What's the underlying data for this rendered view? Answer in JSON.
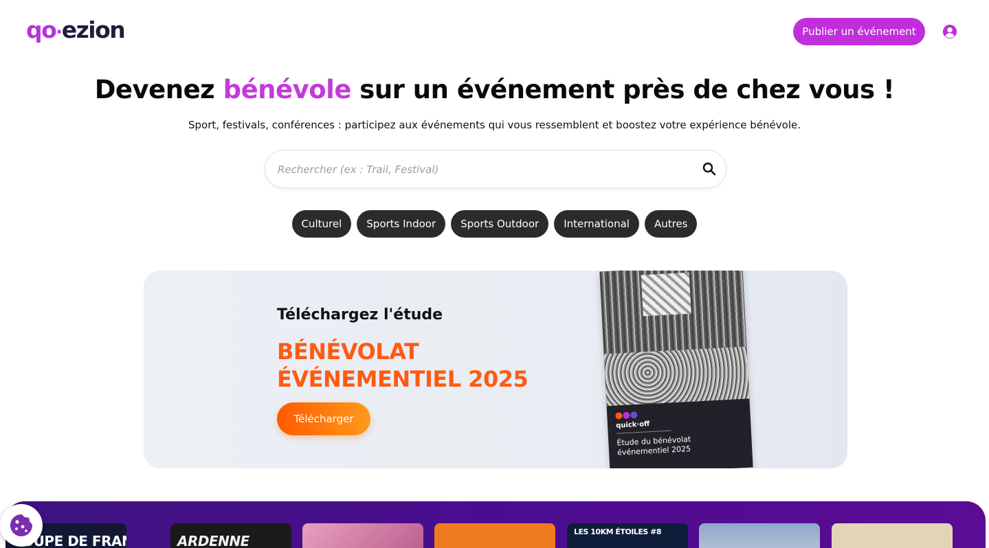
{
  "header": {
    "logo": {
      "part1": "qo",
      "separator": "·",
      "part2": "ezion"
    },
    "publish_label": "Publier un événement",
    "user_icon": "user-circle-icon"
  },
  "hero": {
    "title_before": "Devenez ",
    "title_accent": "bénévole",
    "title_after": " sur un événement près de chez vous !",
    "subtitle": "Sport, festivals, conférences : participez aux événements qui vous ressemblent et boostez votre expérience bénévole."
  },
  "search": {
    "placeholder": "Rechercher (ex : Trail, Festival)",
    "icon": "search-icon"
  },
  "categories": [
    {
      "label": "Culturel"
    },
    {
      "label": "Sports Indoor"
    },
    {
      "label": "Sports Outdoor"
    },
    {
      "label": "International"
    },
    {
      "label": "Autres"
    }
  ],
  "banner": {
    "kicker": "Téléchargez l'étude",
    "title_line1": "BÉNÉVOLAT",
    "title_line2": "ÉVÉNEMENTIEL 2025",
    "button_label": "Télécharger",
    "cover": {
      "brand": "quick·off",
      "title": "Étude du bénévolat événementiel 2025"
    }
  },
  "events_carousel": [
    {
      "label": "COUPE DE FRANCE",
      "color": "#121833"
    },
    {
      "label": "ARDENNE",
      "color": "#1a1a1a"
    },
    {
      "label": "",
      "color": "#c76aa0"
    },
    {
      "label": "",
      "color": "#f07a20"
    },
    {
      "label": "LES 10KM ÉTOILES #8",
      "color": "#0e1d3a"
    },
    {
      "label": "",
      "color": "#7a8fb8"
    },
    {
      "label": "",
      "color": "#d8c9a8"
    }
  ],
  "cookie": {
    "icon": "cookie-icon"
  },
  "colors": {
    "brand_purple": "#c02fd9",
    "accent_orange": "#ff5a12",
    "chip_bg": "#2b2b2b"
  }
}
